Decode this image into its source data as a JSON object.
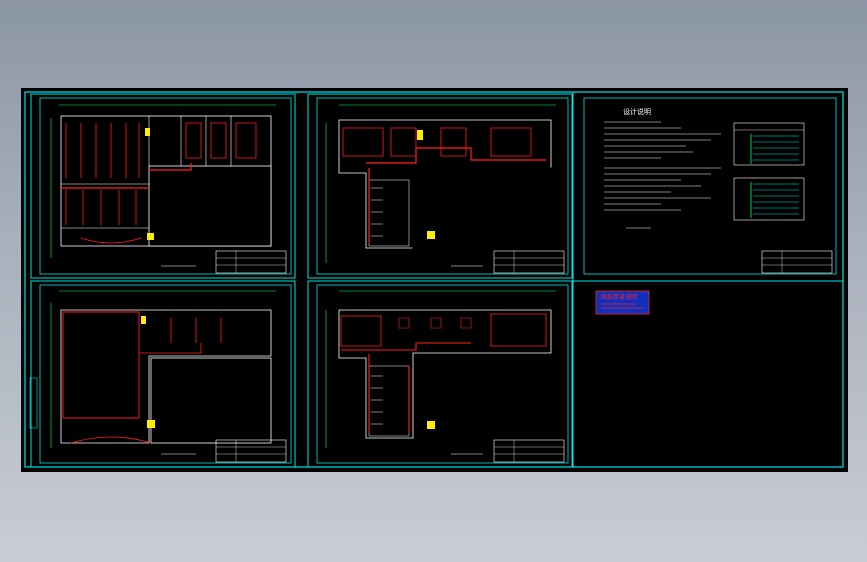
{
  "colors": {
    "background": "#000000",
    "frame": "#00e5e5",
    "wall": "#ffffff",
    "circuit": "#ff2020",
    "dimension": "#00ff66",
    "accent_yellow": "#ffee00",
    "stamp_blue": "#1030c0",
    "stamp_red": "#ff2020"
  },
  "sheets": [
    {
      "id": "plan-1",
      "kind": "floor-plan"
    },
    {
      "id": "plan-2",
      "kind": "floor-plan"
    },
    {
      "id": "notes",
      "kind": "design-notes"
    },
    {
      "id": "plan-3",
      "kind": "floor-plan"
    },
    {
      "id": "plan-4",
      "kind": "floor-plan"
    },
    {
      "id": "stamp",
      "kind": "title-stamp"
    }
  ],
  "notes_title": "设计说明",
  "stamp_title": "图纸目录说明"
}
